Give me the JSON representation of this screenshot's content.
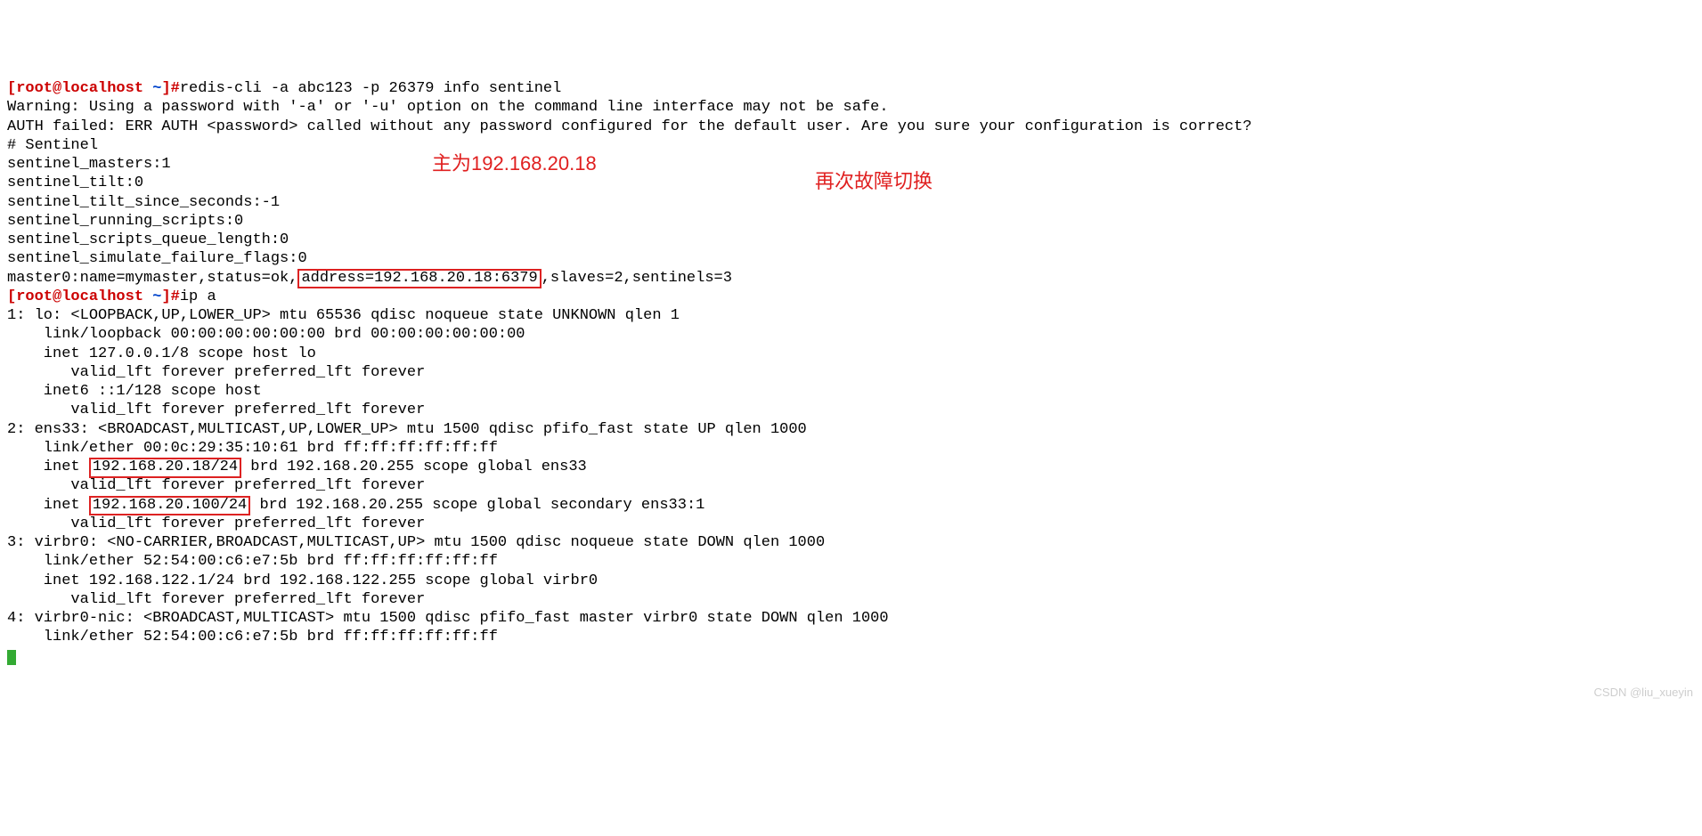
{
  "prompt1": {
    "user": "[root@localhost ",
    "tilde": "~",
    "end": "]#",
    "cmd": "redis-cli -a abc123 -p 26379 info sentinel"
  },
  "output1": {
    "l1": "Warning: Using a password with '-a' or '-u' option on the command line interface may not be safe.",
    "l2": "AUTH failed: ERR AUTH <password> called without any password configured for the default user. Are you sure your configuration is correct?",
    "l3": "# Sentinel",
    "l4": "sentinel_masters:1",
    "l5": "sentinel_tilt:0",
    "l6": "sentinel_tilt_since_seconds:-1",
    "l7": "sentinel_running_scripts:0",
    "l8": "sentinel_scripts_queue_length:0",
    "l9": "sentinel_simulate_failure_flags:0",
    "master_pre": "master0:name=mymaster,status=ok,",
    "master_hl": "address=192.168.20.18:6379",
    "master_post": ",slaves=2,sentinels=3"
  },
  "prompt2": {
    "user": "[root@localhost ",
    "tilde": "~",
    "end": "]#",
    "cmd": "ip a"
  },
  "ip": {
    "lo1": "1: lo: <LOOPBACK,UP,LOWER_UP> mtu 65536 qdisc noqueue state UNKNOWN qlen 1",
    "lo2": "    link/loopback 00:00:00:00:00:00 brd 00:00:00:00:00:00",
    "lo3": "    inet 127.0.0.1/8 scope host lo",
    "lo4": "       valid_lft forever preferred_lft forever",
    "lo5": "    inet6 ::1/128 scope host",
    "lo6": "       valid_lft forever preferred_lft forever",
    "ens1": "2: ens33: <BROADCAST,MULTICAST,UP,LOWER_UP> mtu 1500 qdisc pfifo_fast state UP qlen 1000",
    "ens2": "    link/ether 00:0c:29:35:10:61 brd ff:ff:ff:ff:ff:ff",
    "ens3_pre": "    inet ",
    "ens3_hl": "192.168.20.18/24",
    "ens3_post": " brd 192.168.20.255 scope global ens33",
    "ens4": "       valid_lft forever preferred_lft forever",
    "ens5_pre": "    inet ",
    "ens5_hl": "192.168.20.100/24",
    "ens5_post": " brd 192.168.20.255 scope global secondary ens33:1",
    "ens6": "       valid_lft forever preferred_lft forever",
    "vbr1": "3: virbr0: <NO-CARRIER,BROADCAST,MULTICAST,UP> mtu 1500 qdisc noqueue state DOWN qlen 1000",
    "vbr2": "    link/ether 52:54:00:c6:e7:5b brd ff:ff:ff:ff:ff:ff",
    "vbr3": "    inet 192.168.122.1/24 brd 192.168.122.255 scope global virbr0",
    "vbr4": "       valid_lft forever preferred_lft forever",
    "vnic1": "4: virbr0-nic: <BROADCAST,MULTICAST> mtu 1500 qdisc pfifo_fast master virbr0 state DOWN qlen 1000",
    "vnic2": "    link/ether 52:54:00:c6:e7:5b brd ff:ff:ff:ff:ff:ff"
  },
  "annotations": {
    "a1": "主为192.168.20.18",
    "a2": "再次故障切换"
  },
  "watermark": "CSDN @liu_xueyin"
}
